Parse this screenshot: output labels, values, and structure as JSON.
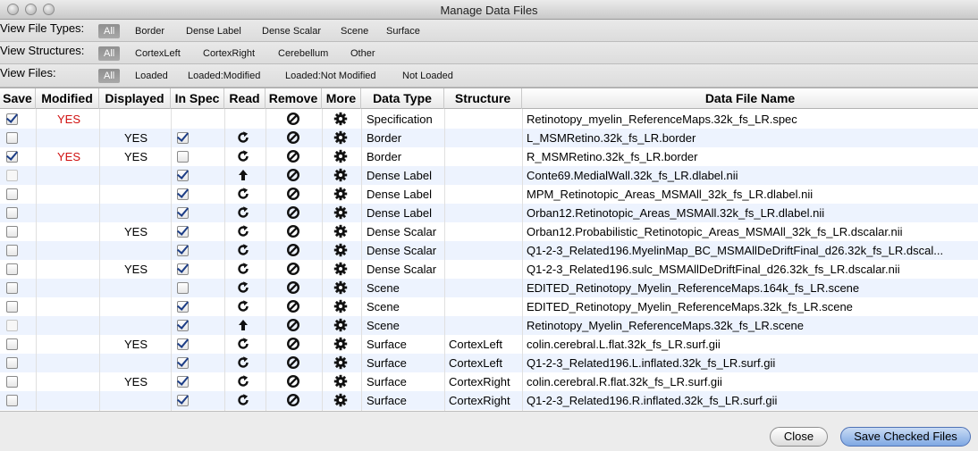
{
  "window": {
    "title": "Manage Data Files"
  },
  "filters": {
    "file_types": {
      "label": "View File Types:",
      "options": [
        "All",
        "Border",
        "Dense Label",
        "Dense Scalar",
        "Scene",
        "Surface"
      ]
    },
    "structures": {
      "label": "View Structures:",
      "options": [
        "All",
        "CortexLeft",
        "CortexRight",
        "Cerebellum",
        "Other"
      ]
    },
    "files": {
      "label": "View Files:",
      "options": [
        "All",
        "Loaded",
        "Loaded:Modified",
        "Loaded:Not Modified",
        "Not Loaded"
      ]
    }
  },
  "columns": [
    "Save",
    "Modified",
    "Displayed",
    "In Spec",
    "Read",
    "Remove",
    "More",
    "Data Type",
    "Structure",
    "Data File Name"
  ],
  "rows": [
    {
      "save": "checked",
      "modified": "YES",
      "displayed": "",
      "in_spec": "none",
      "read": "none",
      "type": "Specification",
      "structure": "",
      "name": "Retinotopy_myelin_ReferenceMaps.32k_fs_LR.spec"
    },
    {
      "save": "unchecked",
      "modified": "",
      "displayed": "YES",
      "in_spec": "checked",
      "read": "reload",
      "type": "Border",
      "structure": "",
      "name": "L_MSMRetino.32k_fs_LR.border"
    },
    {
      "save": "checked",
      "modified": "YES",
      "displayed": "YES",
      "in_spec": "unchecked",
      "read": "reload",
      "type": "Border",
      "structure": "",
      "name": "R_MSMRetino.32k_fs_LR.border"
    },
    {
      "save": "disabled",
      "modified": "",
      "displayed": "",
      "in_spec": "checked",
      "read": "load",
      "type": "Dense Label",
      "structure": "",
      "name": "Conte69.MedialWall.32k_fs_LR.dlabel.nii"
    },
    {
      "save": "unchecked",
      "modified": "",
      "displayed": "",
      "in_spec": "checked",
      "read": "reload",
      "type": "Dense Label",
      "structure": "",
      "name": "MPM_Retinotopic_Areas_MSMAll_32k_fs_LR.dlabel.nii"
    },
    {
      "save": "unchecked",
      "modified": "",
      "displayed": "",
      "in_spec": "checked",
      "read": "reload",
      "type": "Dense Label",
      "structure": "",
      "name": "Orban12.Retinotopic_Areas_MSMAll.32k_fs_LR.dlabel.nii"
    },
    {
      "save": "unchecked",
      "modified": "",
      "displayed": "YES",
      "in_spec": "checked",
      "read": "reload",
      "type": "Dense Scalar",
      "structure": "",
      "name": "Orban12.Probabilistic_Retinotopic_Areas_MSMAll_32k_fs_LR.dscalar.nii"
    },
    {
      "save": "unchecked",
      "modified": "",
      "displayed": "",
      "in_spec": "checked",
      "read": "reload",
      "type": "Dense Scalar",
      "structure": "",
      "name": "Q1-2-3_Related196.MyelinMap_BC_MSMAllDeDriftFinal_d26.32k_fs_LR.dscal..."
    },
    {
      "save": "unchecked",
      "modified": "",
      "displayed": "YES",
      "in_spec": "checked",
      "read": "reload",
      "type": "Dense Scalar",
      "structure": "",
      "name": "Q1-2-3_Related196.sulc_MSMAllDeDriftFinal_d26.32k_fs_LR.dscalar.nii"
    },
    {
      "save": "unchecked",
      "modified": "",
      "displayed": "",
      "in_spec": "unchecked",
      "read": "reload",
      "type": "Scene",
      "structure": "",
      "name": "EDITED_Retinotopy_Myelin_ReferenceMaps.164k_fs_LR.scene"
    },
    {
      "save": "unchecked",
      "modified": "",
      "displayed": "",
      "in_spec": "checked",
      "read": "reload",
      "type": "Scene",
      "structure": "",
      "name": "EDITED_Retinotopy_Myelin_ReferenceMaps.32k_fs_LR.scene"
    },
    {
      "save": "disabled",
      "modified": "",
      "displayed": "",
      "in_spec": "checked",
      "read": "load",
      "type": "Scene",
      "structure": "",
      "name": "Retinotopy_Myelin_ReferenceMaps.32k_fs_LR.scene"
    },
    {
      "save": "unchecked",
      "modified": "",
      "displayed": "YES",
      "in_spec": "checked",
      "read": "reload",
      "type": "Surface",
      "structure": "CortexLeft",
      "name": "colin.cerebral.L.flat.32k_fs_LR.surf.gii"
    },
    {
      "save": "unchecked",
      "modified": "",
      "displayed": "",
      "in_spec": "checked",
      "read": "reload",
      "type": "Surface",
      "structure": "CortexLeft",
      "name": "Q1-2-3_Related196.L.inflated.32k_fs_LR.surf.gii"
    },
    {
      "save": "unchecked",
      "modified": "",
      "displayed": "YES",
      "in_spec": "checked",
      "read": "reload",
      "type": "Surface",
      "structure": "CortexRight",
      "name": "colin.cerebral.R.flat.32k_fs_LR.surf.gii"
    },
    {
      "save": "unchecked",
      "modified": "",
      "displayed": "",
      "in_spec": "checked",
      "read": "reload",
      "type": "Surface",
      "structure": "CortexRight",
      "name": "Q1-2-3_Related196.R.inflated.32k_fs_LR.surf.gii"
    }
  ],
  "icons": {
    "read_reload": "reload-icon",
    "read_load": "upload-arrow-icon",
    "remove": "remove-icon",
    "more": "gear-icon"
  },
  "buttons": {
    "close": "Close",
    "save_checked": "Save Checked Files"
  },
  "colors": {
    "modified_text": "#d01010",
    "checkbox_check": "#1c3d86",
    "alt_row": "#edf3fe",
    "default_button": "#7fa8e3"
  }
}
